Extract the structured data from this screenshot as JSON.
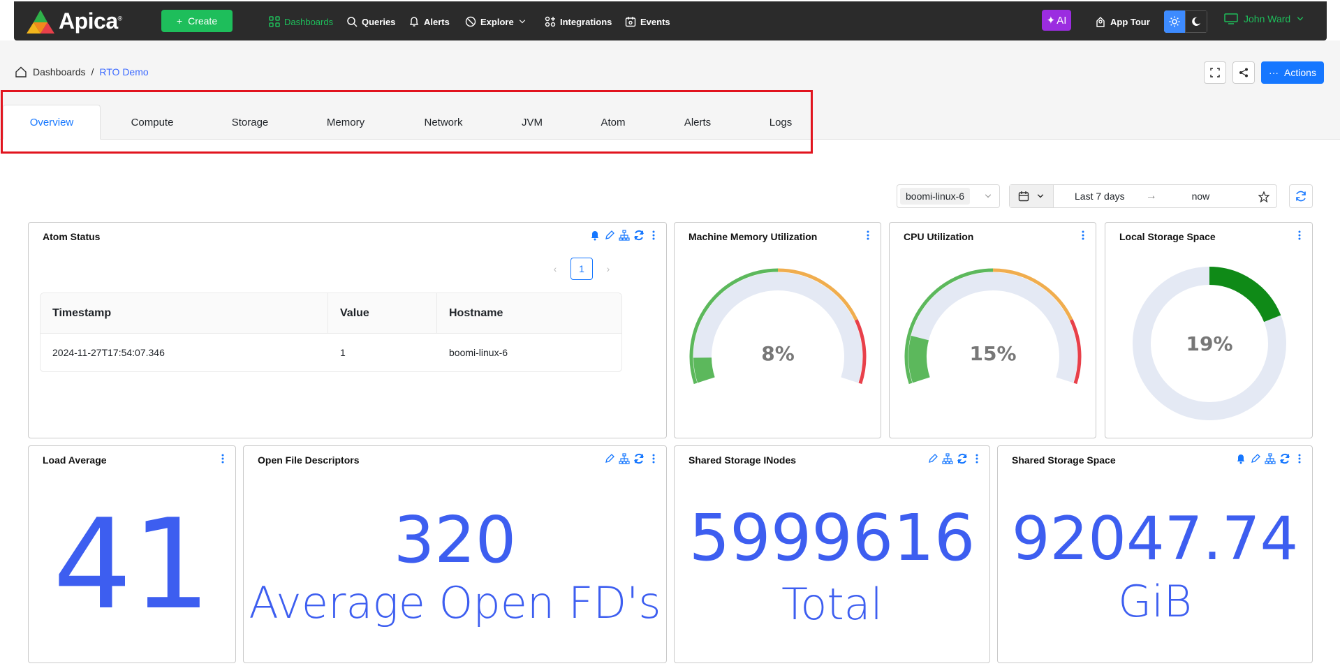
{
  "app": {
    "name": "Apica",
    "trademark": "®"
  },
  "nav": {
    "create": "Create",
    "items": [
      "Dashboards",
      "Queries",
      "Alerts",
      "Explore",
      "Integrations",
      "Events"
    ],
    "ai": "AI",
    "app_tour": "App Tour",
    "user": "John Ward"
  },
  "breadcrumb": {
    "root": "Dashboards",
    "separator": "/",
    "current": "RTO Demo"
  },
  "actions": {
    "label": "Actions"
  },
  "tabs": [
    "Overview",
    "Compute",
    "Storage",
    "Memory",
    "Network",
    "JVM",
    "Atom",
    "Alerts",
    "Logs"
  ],
  "filters": {
    "host": "boomi-linux-6",
    "range_start": "Last 7 days",
    "range_end": "now"
  },
  "panels": {
    "atom_status": {
      "title": "Atom Status",
      "page": "1",
      "columns": [
        "Timestamp",
        "Value",
        "Hostname"
      ],
      "rows": [
        [
          "2024-11-27T17:54:07.346",
          "1",
          "boomi-linux-6"
        ]
      ]
    },
    "memory": {
      "title": "Machine Memory Utilization",
      "value": 8,
      "label": "8%"
    },
    "cpu": {
      "title": "CPU Utilization",
      "value": 15,
      "label": "15%"
    },
    "local_storage": {
      "title": "Local Storage Space",
      "value": 19,
      "label": "19%"
    },
    "load_avg": {
      "title": "Load Average",
      "value": "41"
    },
    "open_fd": {
      "title": "Open File Descriptors",
      "value": "320",
      "unit": "Average Open FD's"
    },
    "inodes": {
      "title": "Shared Storage INodes",
      "value": "5999616",
      "unit": "Total"
    },
    "shared_space": {
      "title": "Shared Storage Space",
      "value": "92047.74",
      "unit": "GiB"
    }
  },
  "colors": {
    "accent": "#1677ff",
    "brand_green": "#1ebe5b",
    "gauge_green": "#5cb85c",
    "gauge_yellow": "#f0ad4e",
    "gauge_red": "#e8404a",
    "number_blue": "#3d5ef0"
  }
}
